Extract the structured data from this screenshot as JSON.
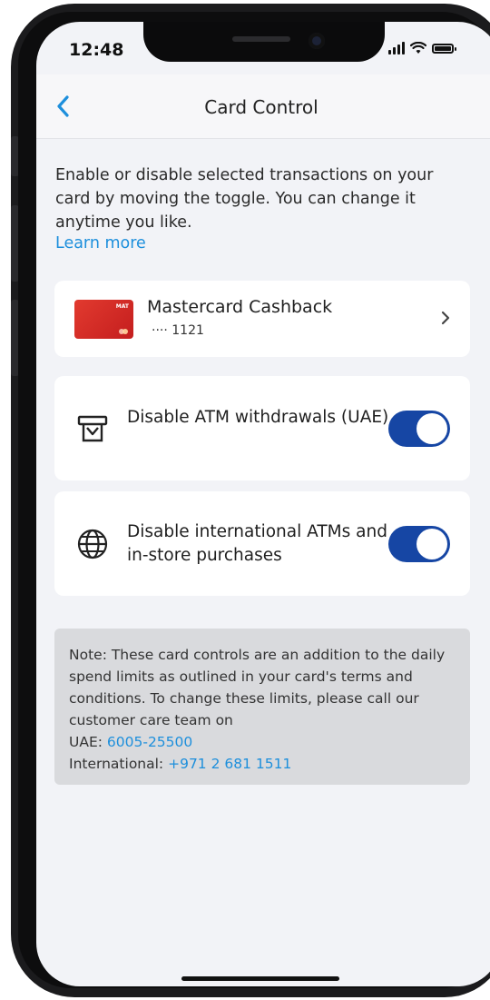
{
  "status": {
    "time": "12:48"
  },
  "nav": {
    "title": "Card Control"
  },
  "intro": {
    "description": "Enable or disable selected transactions on your card by moving the toggle. You can change it anytime you like.",
    "learn_more": "Learn more"
  },
  "card": {
    "name": "Mastercard Cashback",
    "number": "···· 1121",
    "thumb_text": "MAT"
  },
  "controls": [
    {
      "label": "Disable ATM withdrawals (UAE)",
      "icon": "atm-icon",
      "enabled": true
    },
    {
      "label": "Disable international ATMs and in-store purchases",
      "icon": "globe-icon",
      "enabled": true
    }
  ],
  "note": {
    "text": "Note: These card controls are an addition to the daily spend limits as outlined in your card's terms and conditions. To change these limits, please call our customer care team on",
    "uae_label": "UAE:",
    "uae_phone": "6005-25500",
    "intl_label": "International:",
    "intl_phone": "+971 2 681 1511"
  },
  "colors": {
    "accent": "#1d8fdc",
    "toggle_on": "#1646a4",
    "background": "#f2f3f7",
    "note_bg": "#d9dadd"
  }
}
